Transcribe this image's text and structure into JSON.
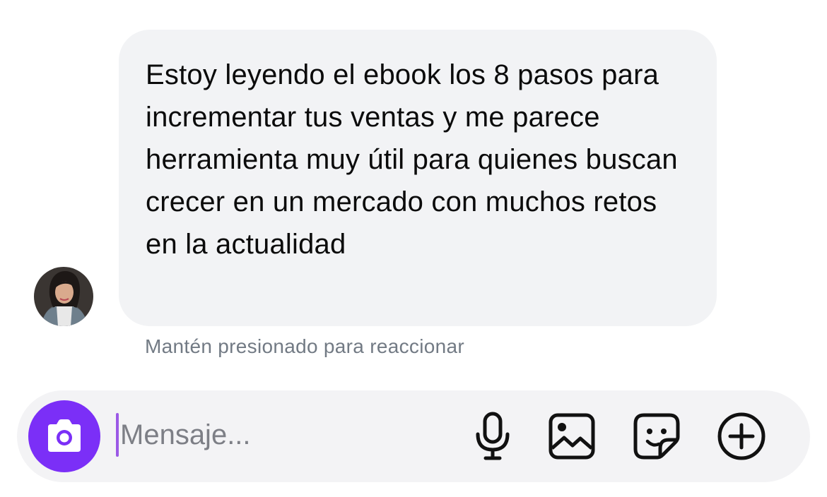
{
  "message": {
    "text": "Estoy leyendo el ebook los 8 pasos para incrementar tus ventas y me parece herramienta muy útil para quienes buscan crecer en un mercado con muchos retos en la actualidad",
    "hint": "Mantén presionado para reaccionar"
  },
  "composer": {
    "placeholder": "Mensaje...",
    "value": "",
    "icons": [
      "camera-icon",
      "microphone-icon",
      "gallery-icon",
      "sticker-icon",
      "plus-circle-icon"
    ]
  },
  "colors": {
    "accent": "#7b2ff7",
    "bubble": "#f2f3f5",
    "composer": "#f3f3f5",
    "hint": "#727a84"
  }
}
